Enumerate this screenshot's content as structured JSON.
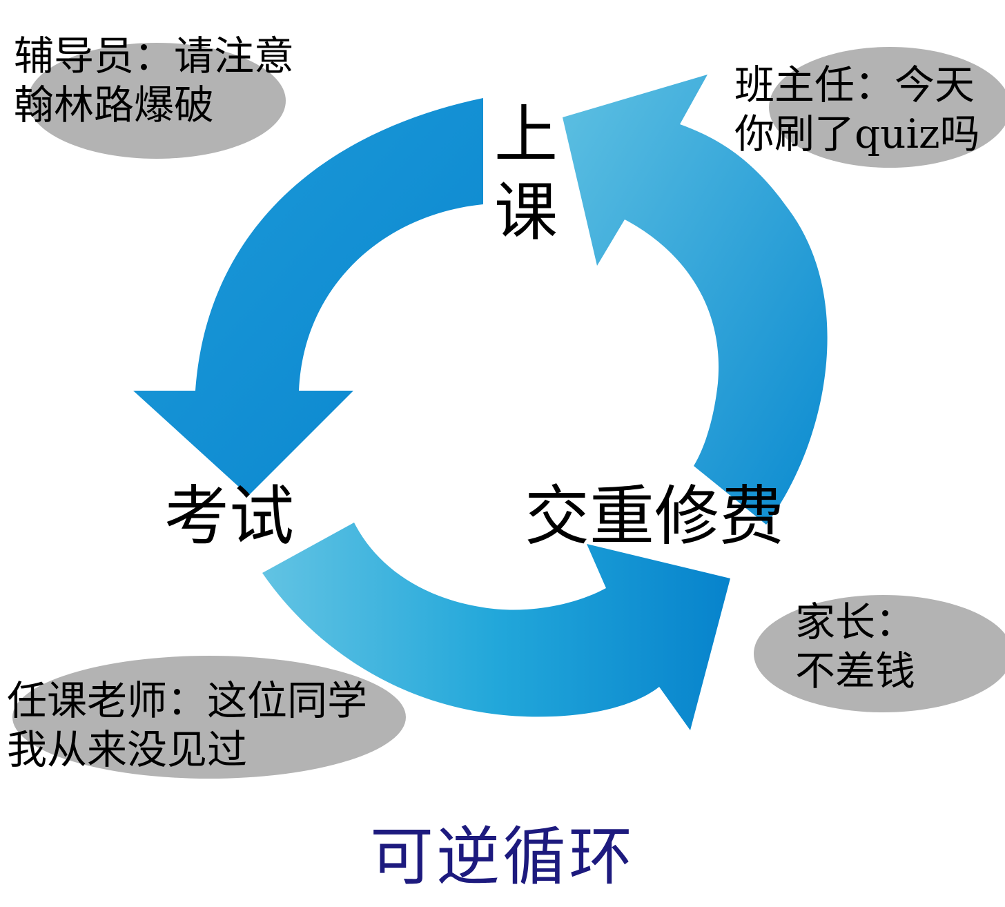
{
  "stages": {
    "class": "上课",
    "exam": "考试",
    "fee": "交重修费"
  },
  "speech": {
    "counselor": {
      "line1": "辅导员：请注意",
      "line2": "翰林路爆破"
    },
    "head_teacher": {
      "line1": "班主任：今天",
      "line2": "你刷了quiz吗"
    },
    "parents": {
      "line1": "家长：",
      "line2": "不差钱"
    },
    "instructor": {
      "line1": "任课老师：这位同学",
      "line2": "我从来没见过"
    }
  },
  "title": "可逆循环",
  "colors": {
    "arrow_dark": "#0a8ad0",
    "arrow_light": "#5ec0e2",
    "bubble": "#b3b3b3",
    "title": "#1d1a7e"
  }
}
